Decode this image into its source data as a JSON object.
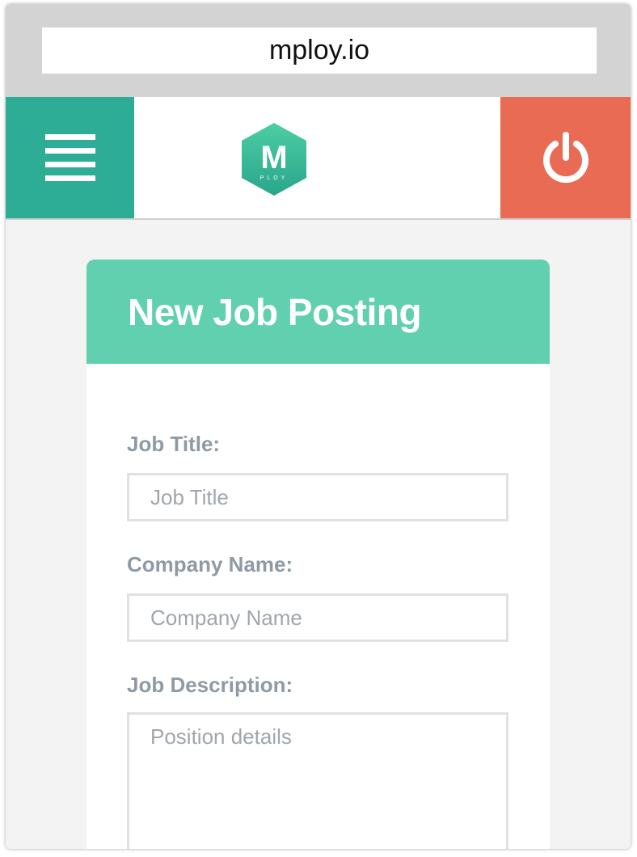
{
  "browser": {
    "url": "mploy.io"
  },
  "header": {
    "menu_icon": "hamburger-menu-icon",
    "logo_letter": "M",
    "logo_subtext": "PLOY",
    "power_icon": "power-icon",
    "colors": {
      "menu_bg": "#2dad95",
      "power_bg": "#ea6b53",
      "logo": "#3cbf9b"
    }
  },
  "form": {
    "title": "New Job Posting",
    "header_color": "#61d0af",
    "job_title": {
      "label": "Job Title:",
      "value": "",
      "placeholder": "Job Title"
    },
    "company_name": {
      "label": "Company Name:",
      "value": "",
      "placeholder": "Company Name"
    },
    "job_description": {
      "label": "Job Description:",
      "value": "",
      "placeholder": "Position details"
    }
  }
}
